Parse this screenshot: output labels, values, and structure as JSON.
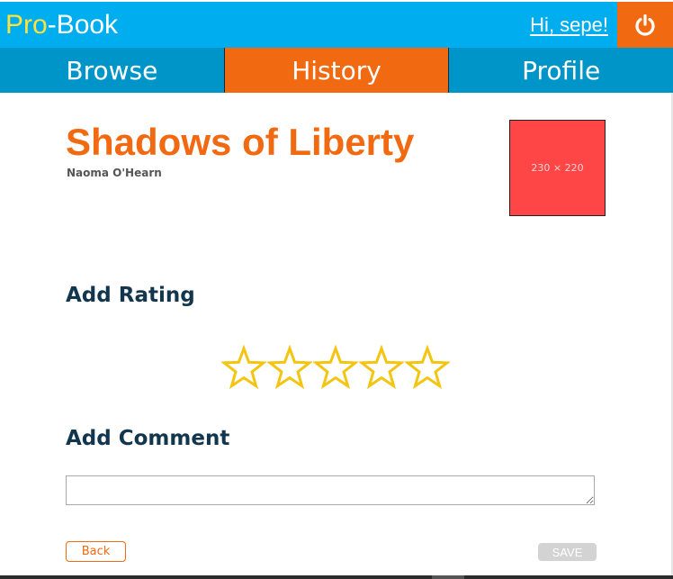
{
  "header": {
    "logo_pro": "Pro",
    "logo_rest": "-Book",
    "greeting": "Hi, sepe!",
    "logout_icon": "power-icon",
    "colors": {
      "bar": "#00adef",
      "logo_pro": "#ffe33b",
      "logout": "#f16a11"
    }
  },
  "nav": {
    "tabs": [
      {
        "label": "Browse",
        "active": false
      },
      {
        "label": "History",
        "active": true
      },
      {
        "label": "Profile",
        "active": false
      }
    ],
    "colors": {
      "bar": "#0095c8",
      "active": "#f16a11"
    }
  },
  "book": {
    "title": "Shadows of Liberty",
    "author": "Naoma O'Hearn",
    "cover_placeholder": "230 × 220",
    "cover_color": "#ff4647"
  },
  "rating": {
    "heading": "Add Rating",
    "max_stars": 5,
    "value": 0,
    "star_icon": "star-outline-icon",
    "star_color": "#f3c410"
  },
  "comment": {
    "heading": "Add Comment",
    "value": ""
  },
  "actions": {
    "back_label": "Back",
    "save_label": "SAVE"
  }
}
